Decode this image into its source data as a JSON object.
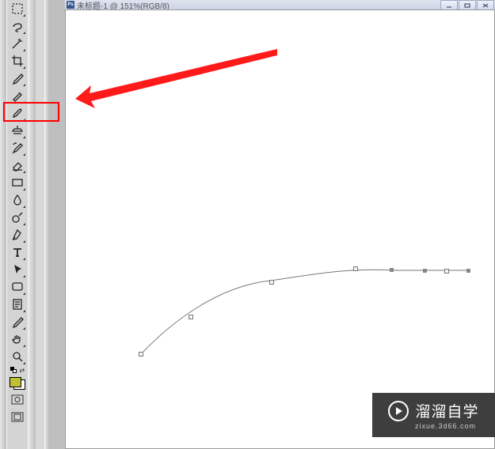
{
  "window": {
    "app_icon_letter": "Ps",
    "title": "未标题-1 @ 151%(RGB/8)"
  },
  "watermark": {
    "brand": "溜溜自学",
    "sub": "zixue.3d66.com"
  },
  "tools": [
    "marquee",
    "lasso",
    "magic-wand",
    "crop",
    "eyedropper",
    "healing-brush",
    "brush",
    "clone-stamp",
    "history-brush",
    "eraser",
    "gradient",
    "blur",
    "dodge",
    "pen",
    "type",
    "path-selection",
    "shape",
    "notes",
    "eyedropper-alt",
    "hand",
    "zoom"
  ],
  "highlighted_tool_index": 6,
  "colors": {
    "foreground": "#bcc233",
    "background": "#ffffff",
    "accent_red": "#ff0000"
  }
}
